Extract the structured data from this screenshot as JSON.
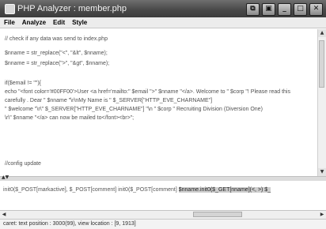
{
  "window": {
    "title": "PHP Analyzer : member.php",
    "controls": [
      "⧉",
      "▣",
      "_",
      "□",
      "✕"
    ]
  },
  "menu": [
    "File",
    "Analyze",
    "Edit",
    "Style"
  ],
  "code_lines": [
    "// check if any data was send to index.php",
    "",
    "$nname = str_replace(\"<\", \"&lt\", $nname);",
    "$nname = str_replace(\">\", \"&gt\", $nname);",
    "",
    "if($email != \"\"){",
    "echo \"<font color='#00FF00'>User <a href='mailto:\" $email \">\" $nname \"</a>. Welcome to \" $corp \"! Please read this",
    "carefully .   Dear \" $nname \"\\r\\nMy Name is \" $_SERVER[\"HTTP_EVE_CHARNAME\"]",
    "\" $welcome \"\\r\\\" $_SERVER[\"HTTP_EVE_CHARNAME\"] \"\\n \" $corp \" Recruiting Division (Diversion One)",
    "\\r\\\" $nname \"</a> can now be mailed to</font><br>\";",
    "",
    "",
    "",
    "//config update"
  ],
  "bottom_pane": {
    "prefix": "init0($_POST[markactive], $_POST[comment] init0($_POST[comment]  ",
    "highlight": "$nname.init0($_GET[nname](<, >) $_",
    "suffix": ""
  },
  "status": "caret: text position : 3000(99), view location : [9, 1913]"
}
